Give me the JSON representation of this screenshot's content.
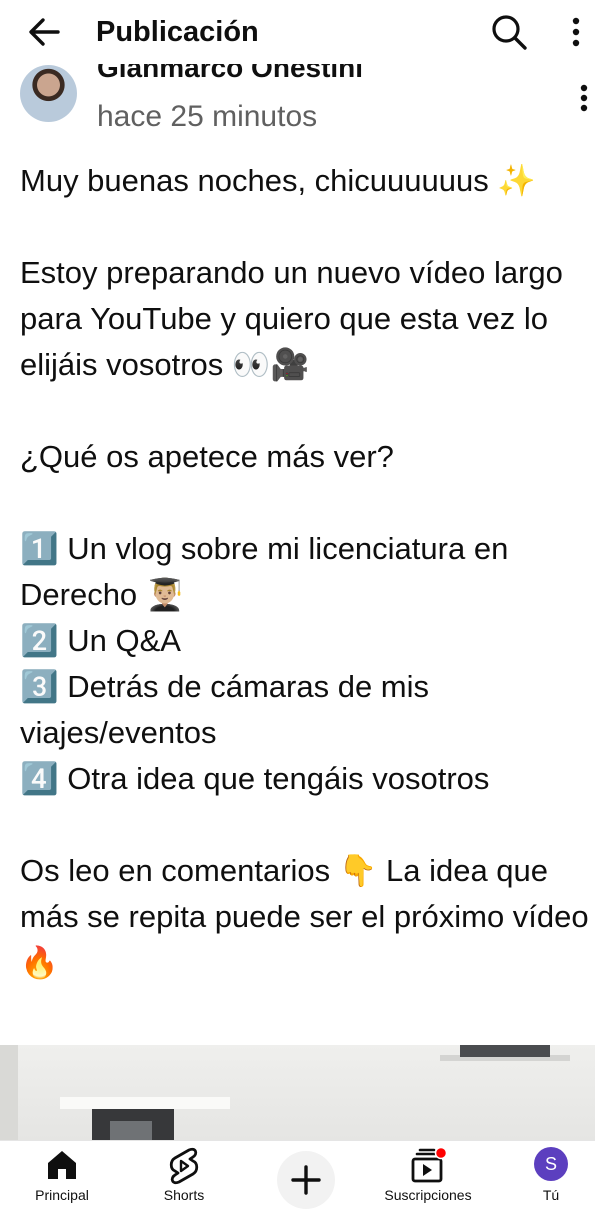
{
  "header": {
    "title": "Publicación"
  },
  "author": {
    "name": "Gianmarco Onestini",
    "time": "hace 25 minutos"
  },
  "post": {
    "text": "Muy buenas noches, chicuuuuuus ✨\n\nEstoy preparando un nuevo vídeo largo para YouTube y quiero que esta vez lo elijáis vosotros 👀🎥\n\n¿Qué os apetece más ver?\n\n1️⃣ Un vlog sobre mi licenciatura en Derecho 👨🏼‍🎓\n2️⃣ Un Q&A\n3️⃣ Detrás de cámaras de mis viajes/eventos\n4️⃣ Otra idea que tengáis vosotros\n\nOs leo en comentarios 👇 La idea que más se repita puede ser el próximo vídeo 🔥"
  },
  "nav": {
    "home": "Principal",
    "shorts": "Shorts",
    "subscriptions": "Suscripciones",
    "you": "Tú",
    "you_initial": "S"
  },
  "colors": {
    "notification_dot": "#ff0000",
    "you_avatar": "#5c3fbf"
  }
}
